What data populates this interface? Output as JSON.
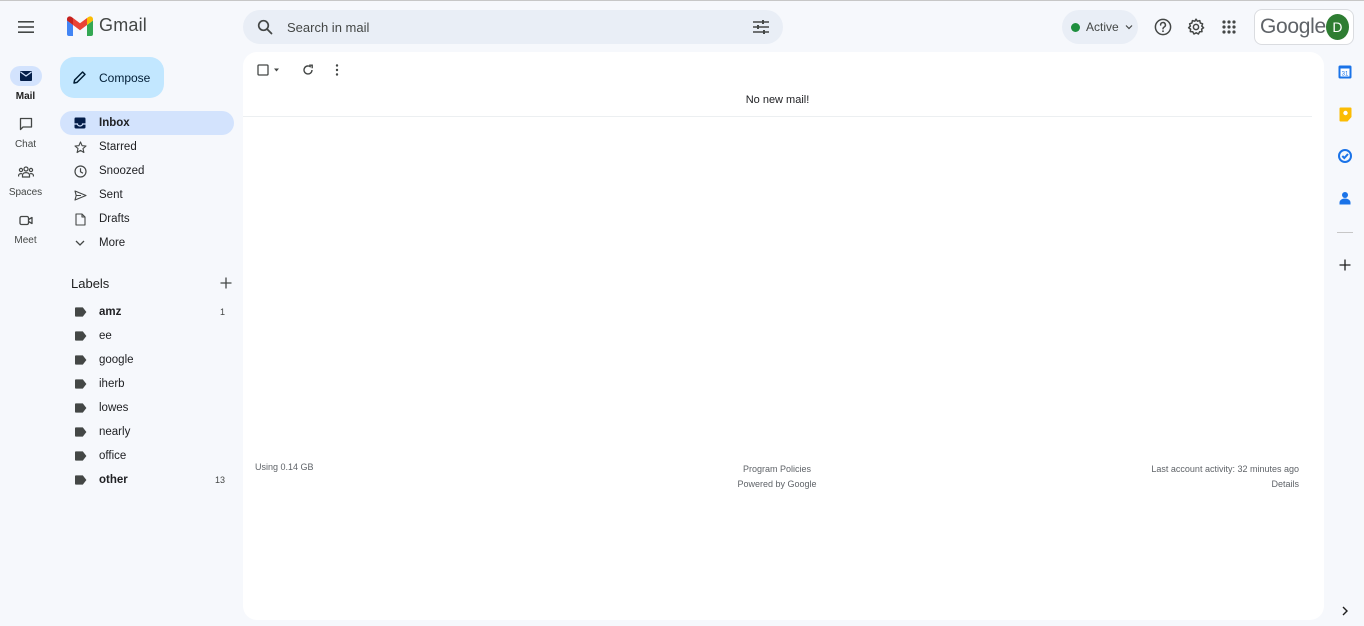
{
  "app": {
    "logo_text": "Gmail"
  },
  "search": {
    "placeholder": "Search in mail",
    "value": ""
  },
  "status": {
    "label": "Active",
    "color": "#1e8e3e"
  },
  "account": {
    "brand": "Google",
    "avatar_letter": "D",
    "avatar_color": "#2e7d32"
  },
  "rail": {
    "items": [
      {
        "label": "Mail",
        "icon": "mail-icon",
        "active": true
      },
      {
        "label": "Chat",
        "icon": "chat-icon",
        "active": false
      },
      {
        "label": "Spaces",
        "icon": "spaces-icon",
        "active": false
      },
      {
        "label": "Meet",
        "icon": "meet-icon",
        "active": false
      }
    ]
  },
  "compose": {
    "label": "Compose"
  },
  "nav": {
    "items": [
      {
        "label": "Inbox",
        "icon": "inbox-icon",
        "active": true
      },
      {
        "label": "Starred",
        "icon": "star-icon"
      },
      {
        "label": "Snoozed",
        "icon": "clock-icon"
      },
      {
        "label": "Sent",
        "icon": "send-icon"
      },
      {
        "label": "Drafts",
        "icon": "draft-icon"
      },
      {
        "label": "More",
        "icon": "chevron-down-icon"
      }
    ]
  },
  "labels": {
    "title": "Labels",
    "items": [
      {
        "label": "amz",
        "count": "1",
        "bold": true
      },
      {
        "label": "ee",
        "count": ""
      },
      {
        "label": "google",
        "count": ""
      },
      {
        "label": "iherb",
        "count": ""
      },
      {
        "label": "lowes",
        "count": ""
      },
      {
        "label": "nearly",
        "count": ""
      },
      {
        "label": "office",
        "count": ""
      },
      {
        "label": "other",
        "count": "13",
        "bold": true
      }
    ]
  },
  "main": {
    "empty_message": "No new mail!",
    "footer": {
      "storage": "Using 0.14 GB",
      "program_policies": "Program Policies",
      "powered_by": "Powered by Google",
      "last_activity": "Last account activity: 32 minutes ago",
      "details": "Details"
    }
  },
  "side_panel": {
    "icons": [
      "calendar-icon",
      "keep-icon",
      "tasks-icon",
      "contacts-icon",
      "add-icon",
      "expand-panel-icon"
    ]
  }
}
